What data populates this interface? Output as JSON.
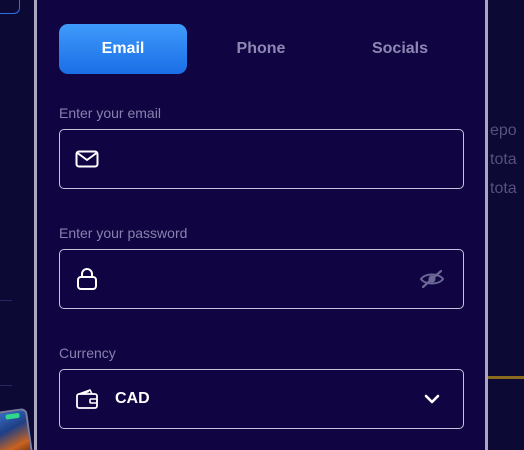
{
  "background": {
    "right_fragments": [
      "epo",
      "tota",
      "tota"
    ]
  },
  "tabs": [
    {
      "label": "Email",
      "active": true
    },
    {
      "label": "Phone",
      "active": false
    },
    {
      "label": "Socials",
      "active": false
    }
  ],
  "email": {
    "label": "Enter your email",
    "value": "",
    "icon": "envelope-icon"
  },
  "password": {
    "label": "Enter your password",
    "value": "",
    "icon": "lock-icon",
    "toggle_icon": "eye-off-icon"
  },
  "currency": {
    "label": "Currency",
    "selected": "CAD",
    "icon": "wallet-icon",
    "chevron_icon": "chevron-down-icon"
  },
  "colors": {
    "accent": "#2b86f5",
    "panel": "#100542",
    "page_bg": "#0d0935",
    "field_border": "#c7c3dd",
    "muted_text": "#8782ad"
  }
}
